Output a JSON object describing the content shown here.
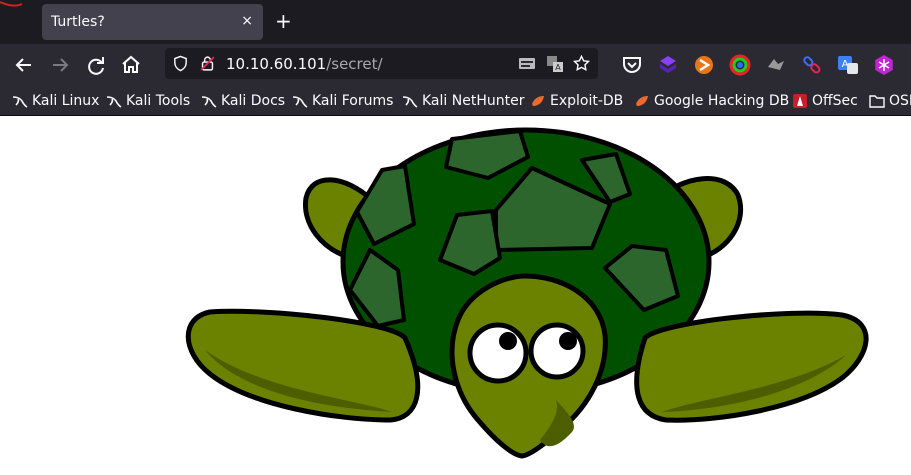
{
  "tab": {
    "title": "Turtles?",
    "close": "×"
  },
  "newtab": "+",
  "url": {
    "host": "10.10.60.101",
    "path": "/secret/"
  },
  "bookmarks": [
    {
      "label": "Kali Linux",
      "icon": "kali-dragon-icon"
    },
    {
      "label": "Kali Tools",
      "icon": "kali-dragon-icon"
    },
    {
      "label": "Kali Docs",
      "icon": "kali-dragon-icon"
    },
    {
      "label": "Kali Forums",
      "icon": "kali-dragon-icon"
    },
    {
      "label": "Kali NetHunter",
      "icon": "kali-dragon-icon"
    },
    {
      "label": "Exploit-DB",
      "icon": "exploit-db-icon"
    },
    {
      "label": "Google Hacking DB",
      "icon": "exploit-db-icon"
    },
    {
      "label": "OffSec",
      "icon": "offsec-icon"
    },
    {
      "label": "OSI",
      "icon": "folder-icon"
    }
  ],
  "colors": {
    "tab_bar": "#1c1b22",
    "toolbar": "#2b2a33",
    "active_tab": "#42414d",
    "shell_dark": "#005000",
    "shell_plate": "#2d662d",
    "body": "#6b8200"
  }
}
